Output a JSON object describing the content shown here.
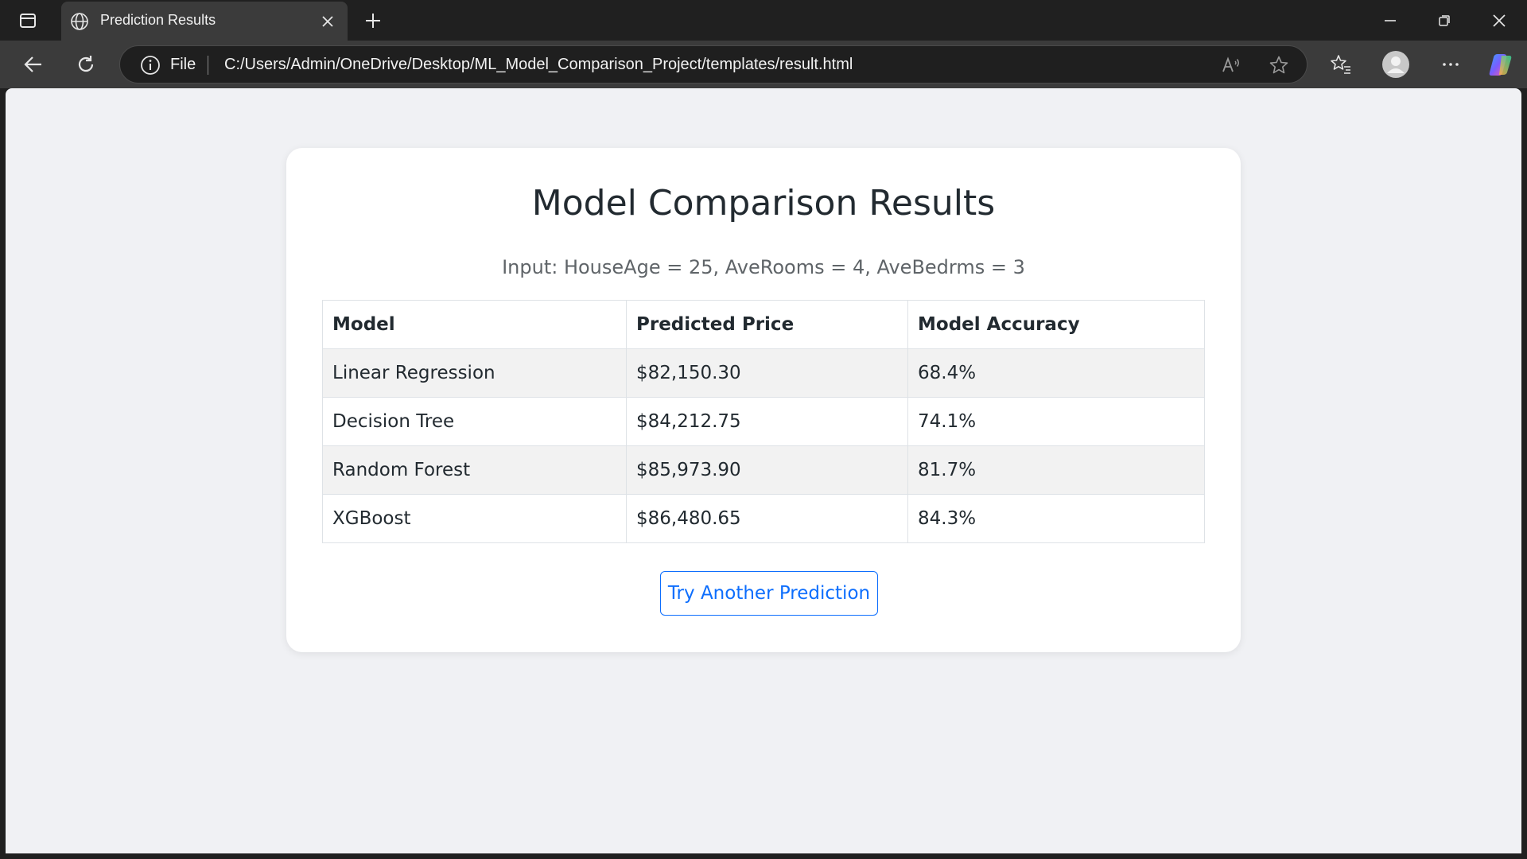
{
  "browser": {
    "tab_title": "Prediction Results",
    "address_scheme": "File",
    "url": "C:/Users/Admin/OneDrive/Desktop/ML_Model_Comparison_Project/templates/result.html",
    "icons": [
      "sidebar-toggle-icon",
      "globe-icon",
      "close-icon",
      "plus-icon",
      "minimize-icon",
      "restore-icon",
      "window-close-icon",
      "back-icon",
      "refresh-icon",
      "info-icon",
      "read-aloud-icon",
      "star-icon",
      "favorites-icon",
      "profile-icon",
      "more-icon",
      "copilot-icon"
    ]
  },
  "page": {
    "title": "Model Comparison Results",
    "input_summary": "Input: HouseAge = 25, AveRooms = 4, AveBedrms = 3",
    "table": {
      "headers": [
        "Model",
        "Predicted Price",
        "Model Accuracy"
      ],
      "rows": [
        [
          "Linear Regression",
          "$82,150.30",
          "68.4%"
        ],
        [
          "Decision Tree",
          "$84,212.75",
          "74.1%"
        ],
        [
          "Random Forest",
          "$85,973.90",
          "81.7%"
        ],
        [
          "XGBoost",
          "$86,480.65",
          "84.3%"
        ]
      ]
    },
    "retry_button_label": "Try Another Prediction"
  },
  "colors": {
    "accent": "#0d6efd",
    "page_bg": "#f0f1f4",
    "card_bg": "#ffffff",
    "stripe": "#f2f2f2"
  }
}
